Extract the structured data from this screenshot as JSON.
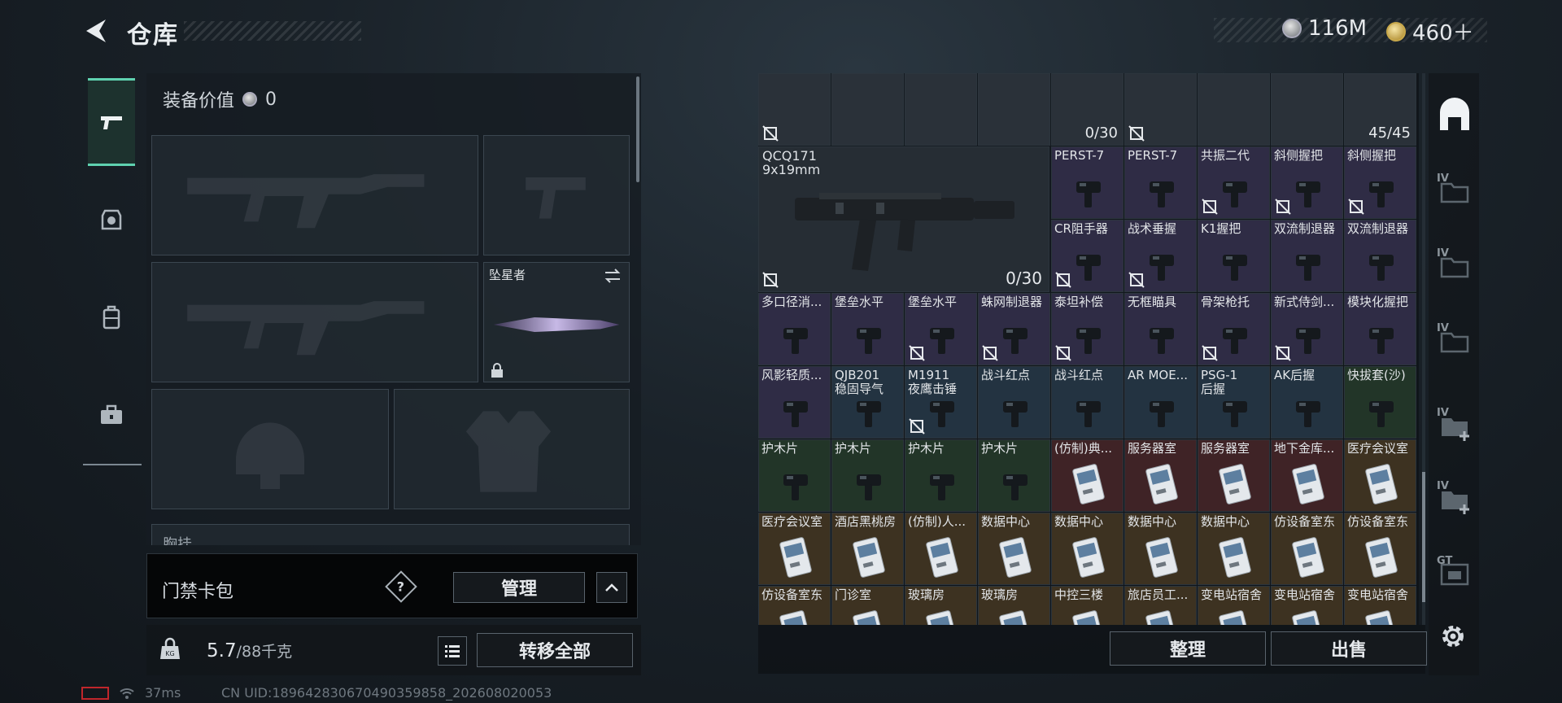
{
  "header": {
    "title": "仓库",
    "currencies": [
      {
        "icon": "silver-coin-icon",
        "value": "116M"
      },
      {
        "icon": "gold-coin-icon",
        "value": "460＋"
      }
    ]
  },
  "left_tabs": [
    {
      "icon": "pistol-icon",
      "active": true
    },
    {
      "icon": "helmet-vest-icon",
      "active": false
    },
    {
      "icon": "backpack-icon",
      "active": false
    },
    {
      "icon": "toolbox-icon",
      "active": false
    }
  ],
  "equipment": {
    "value_label": "装备价值",
    "value": "0",
    "knife_name": "坠星者",
    "chest_label": "胸挂"
  },
  "keycard": {
    "label": "门禁卡包",
    "help": "?",
    "manage_label": "管理"
  },
  "weight": {
    "current": "5.7",
    "capacity": "/88千克",
    "transfer_label": "转移全部"
  },
  "status": {
    "ping": "37ms",
    "uid": "CN UID:189642830670490359858_202608020053"
  },
  "inventory": {
    "top_row_counts": [
      "0/30",
      "45/45"
    ],
    "weapon": {
      "name": "QCQ171\n9x19mm",
      "count": "0/30"
    },
    "items": [
      {
        "name": "PERST-7",
        "bg": "purple",
        "nolink": false
      },
      {
        "name": "PERST-7",
        "bg": "purple",
        "nolink": false
      },
      {
        "name": "共振二代",
        "bg": "purple",
        "nolink": true
      },
      {
        "name": "斜侧握把",
        "bg": "purple",
        "nolink": true
      },
      {
        "name": "斜侧握把",
        "bg": "purple",
        "nolink": true
      },
      {
        "name": "CR阻手器",
        "bg": "purple",
        "nolink": true
      },
      {
        "name": "战术垂握",
        "bg": "purple",
        "nolink": true
      },
      {
        "name": "K1握把",
        "bg": "purple",
        "nolink": false
      },
      {
        "name": "双流制退器",
        "bg": "purple",
        "nolink": false
      },
      {
        "name": "双流制退器",
        "bg": "purple",
        "nolink": false
      },
      {
        "name": "多口径消...",
        "bg": "purple",
        "nolink": false
      },
      {
        "name": "堡垒水平",
        "bg": "purple",
        "nolink": false
      },
      {
        "name": "堡垒水平",
        "bg": "purple",
        "nolink": true
      },
      {
        "name": "蛛网制退器",
        "bg": "purple",
        "nolink": true
      },
      {
        "name": "泰坦补偿",
        "bg": "purple",
        "nolink": true
      },
      {
        "name": "无框瞄具",
        "bg": "purple",
        "nolink": false
      },
      {
        "name": "骨架枪托",
        "bg": "purple",
        "nolink": true
      },
      {
        "name": "新式侍剑...",
        "bg": "purple",
        "nolink": true
      },
      {
        "name": "模块化握把",
        "bg": "purple",
        "nolink": false
      },
      {
        "name": "风影轻质...",
        "bg": "purple",
        "nolink": false
      },
      {
        "name": "QJB201\n稳固导气",
        "bg": "blue",
        "nolink": false
      },
      {
        "name": "M1911\n夜鹰击锤",
        "bg": "blue",
        "nolink": true
      },
      {
        "name": "战斗红点",
        "bg": "blue",
        "nolink": false
      },
      {
        "name": "战斗红点",
        "bg": "blue",
        "nolink": false
      },
      {
        "name": "AR MOE...",
        "bg": "blue",
        "nolink": false
      },
      {
        "name": "PSG-1\n后握",
        "bg": "blue",
        "nolink": false
      },
      {
        "name": "AK后握",
        "bg": "blue",
        "nolink": false
      },
      {
        "name": "快拔套(沙)",
        "bg": "green",
        "nolink": false
      },
      {
        "name": "护木片",
        "bg": "green",
        "nolink": false
      },
      {
        "name": "护木片",
        "bg": "green",
        "nolink": false
      },
      {
        "name": "护木片",
        "bg": "green",
        "nolink": false
      },
      {
        "name": "护木片",
        "bg": "green",
        "nolink": false
      },
      {
        "name": "(仿制)典...",
        "bg": "red",
        "nolink": false
      },
      {
        "name": "服务器室",
        "bg": "red",
        "nolink": false
      },
      {
        "name": "服务器室",
        "bg": "red",
        "nolink": false
      },
      {
        "name": "地下金库...",
        "bg": "red",
        "nolink": false
      },
      {
        "name": "医疗会议室",
        "bg": "gold",
        "nolink": false
      },
      {
        "name": "医疗会议室",
        "bg": "gold",
        "nolink": false
      },
      {
        "name": "酒店黑桃房",
        "bg": "gold",
        "nolink": false
      },
      {
        "name": "(仿制)人...",
        "bg": "gold",
        "nolink": false
      },
      {
        "name": "数据中心",
        "bg": "gold",
        "nolink": false
      },
      {
        "name": "数据中心",
        "bg": "gold",
        "nolink": false
      },
      {
        "name": "数据中心",
        "bg": "gold",
        "nolink": false
      },
      {
        "name": "数据中心",
        "bg": "gold",
        "nolink": false
      },
      {
        "name": "仿设备室东",
        "bg": "gold",
        "nolink": false
      },
      {
        "name": "仿设备室东",
        "bg": "gold",
        "nolink": false
      },
      {
        "name": "仿设备室东",
        "bg": "gold",
        "nolink": false
      },
      {
        "name": "门诊室",
        "bg": "gold",
        "nolink": false
      },
      {
        "name": "玻璃房",
        "bg": "gold",
        "nolink": false
      },
      {
        "name": "玻璃房",
        "bg": "gold",
        "nolink": false
      },
      {
        "name": "中控三楼",
        "bg": "gold",
        "nolink": false
      },
      {
        "name": "旅店员工...",
        "bg": "gold",
        "nolink": false
      },
      {
        "name": "变电站宿舍",
        "bg": "gold",
        "nolink": false
      },
      {
        "name": "变电站宿舍",
        "bg": "gold",
        "nolink": false
      },
      {
        "name": "变电站宿舍",
        "bg": "gold",
        "nolink": false
      }
    ],
    "sort_label": "整理",
    "sell_label": "出售"
  },
  "right_tabs": [
    {
      "icon": "warehouse-icon",
      "level": ""
    },
    {
      "icon": "folder-icon",
      "level": "IV"
    },
    {
      "icon": "folder-icon",
      "level": "IV"
    },
    {
      "icon": "folder-icon",
      "level": "IV"
    },
    {
      "icon": "folder-add-icon",
      "level": "IV"
    },
    {
      "icon": "folder-add-icon",
      "level": "IV"
    },
    {
      "icon": "container-icon",
      "level": "GT"
    }
  ],
  "colors": {
    "accent": "#5fd2b0",
    "purple_tier": "#2f2c45",
    "blue_tier": "#233341",
    "green_tier": "#223528",
    "red_tier": "#3f2326",
    "gold_tier": "#3d3221",
    "battery": "#c0262b"
  }
}
